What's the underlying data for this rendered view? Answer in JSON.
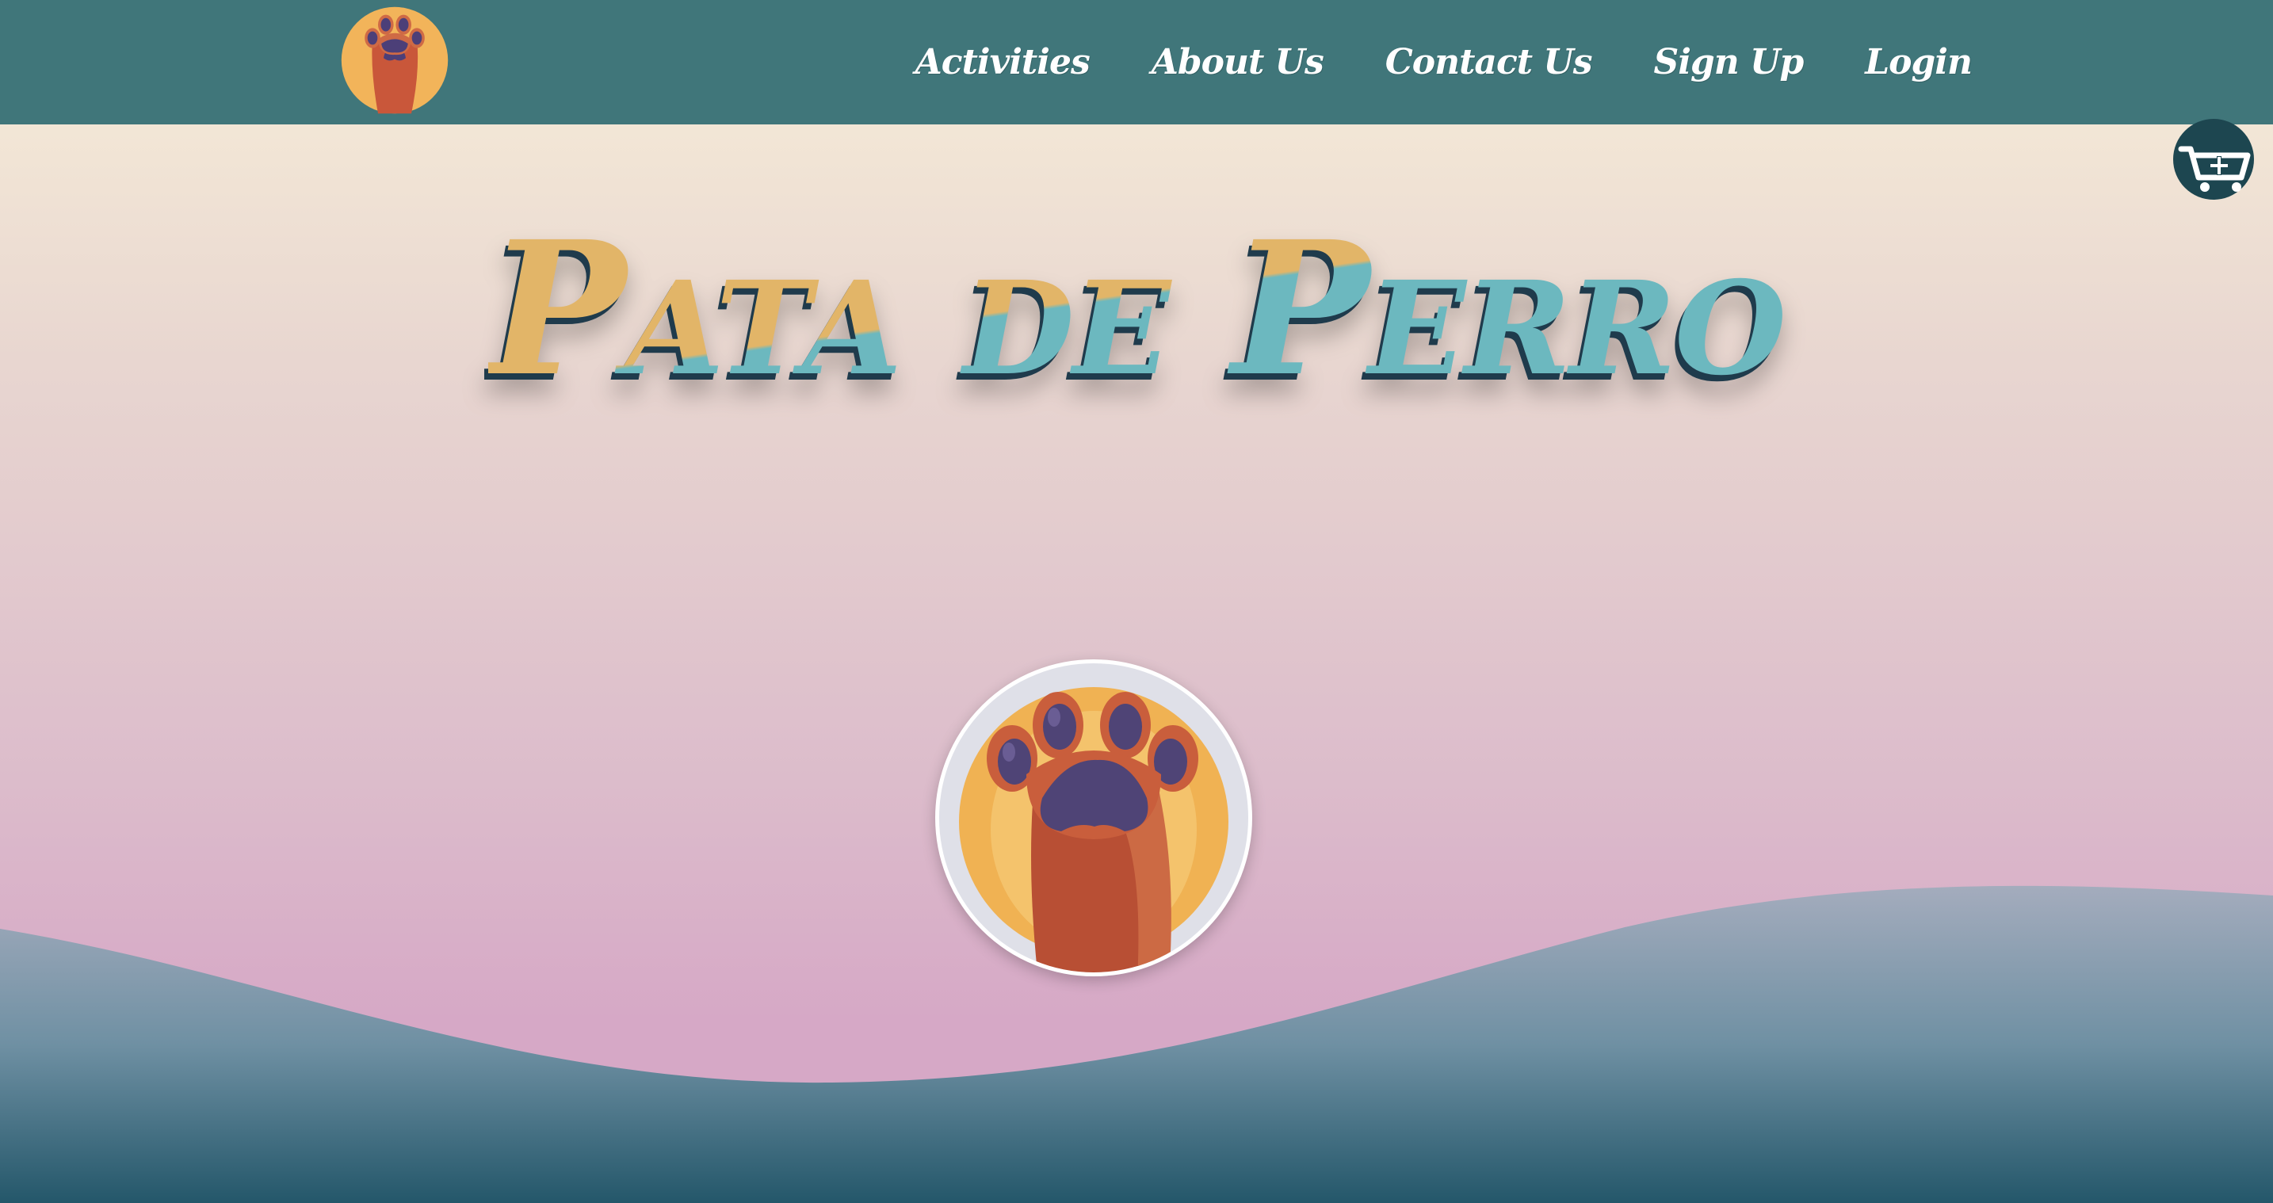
{
  "nav": {
    "logo_icon": "paw-logo-icon",
    "links": [
      {
        "label": "Activities"
      },
      {
        "label": "About Us"
      },
      {
        "label": "Contact Us"
      },
      {
        "label": "Sign Up"
      },
      {
        "label": "Login"
      }
    ]
  },
  "hero": {
    "title": "Pata de Perro",
    "paw_icon": "paw-icon"
  },
  "cart": {
    "icon": "cart-plus-icon"
  },
  "colors": {
    "navbar": "#40767a",
    "title_top": "#e2b568",
    "title_bottom": "#6cb8bf",
    "title_shadow": "#1f3b4c",
    "cart_bg": "#1d4650",
    "wave_top": "#a4acbd",
    "wave_bottom": "#24576a"
  }
}
